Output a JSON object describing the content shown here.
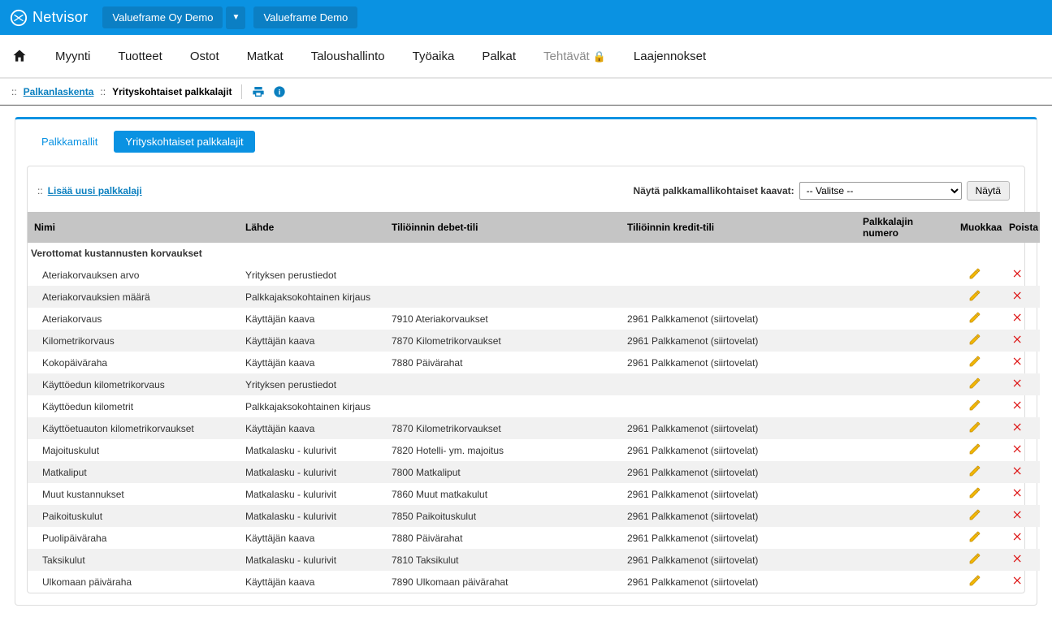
{
  "brand": "Netvisor",
  "company_selector": {
    "primary": "Valueframe Oy Demo",
    "secondary": "Valueframe Demo"
  },
  "mainnav": {
    "items": [
      {
        "label": "Myynti"
      },
      {
        "label": "Tuotteet"
      },
      {
        "label": "Ostot"
      },
      {
        "label": "Matkat"
      },
      {
        "label": "Taloushallinto"
      },
      {
        "label": "Työaika"
      },
      {
        "label": "Palkat"
      },
      {
        "label": "Tehtävät",
        "disabled": true
      },
      {
        "label": "Laajennokset"
      }
    ]
  },
  "breadcrumb": {
    "root": "Palkanlaskenta",
    "current": "Yrityskohtaiset palkkalajit"
  },
  "tabs": {
    "inactive": "Palkkamallit",
    "active": "Yrityskohtaiset palkkalajit"
  },
  "add_link": "Lisää uusi palkkalaji",
  "filter": {
    "label": "Näytä palkkamallikohtaiset kaavat:",
    "selected": "-- Valitse --",
    "button": "Näytä"
  },
  "table": {
    "headers": {
      "nimi": "Nimi",
      "lahde": "Lähde",
      "debet": "Tiliöinnin debet-tili",
      "kredit": "Tiliöinnin kredit-tili",
      "numero": "Palkkalajin numero",
      "muokkaa": "Muokkaa",
      "poista": "Poista"
    },
    "group_title": "Verottomat kustannusten korvaukset",
    "rows": [
      {
        "nimi": "Ateriakorvauksen arvo",
        "lahde": "Yrityksen perustiedot",
        "debet": "",
        "kredit": ""
      },
      {
        "nimi": "Ateriakorvauksien määrä",
        "lahde": "Palkkajaksokohtainen kirjaus",
        "debet": "",
        "kredit": ""
      },
      {
        "nimi": "Ateriakorvaus",
        "lahde": "Käyttäjän kaava",
        "debet": "7910 Ateriakorvaukset",
        "kredit": "2961 Palkkamenot (siirtovelat)"
      },
      {
        "nimi": "Kilometrikorvaus",
        "lahde": "Käyttäjän kaava",
        "debet": "7870 Kilometrikorvaukset",
        "kredit": "2961 Palkkamenot (siirtovelat)"
      },
      {
        "nimi": "Kokopäiväraha",
        "lahde": "Käyttäjän kaava",
        "debet": "7880 Päivärahat",
        "kredit": "2961 Palkkamenot (siirtovelat)"
      },
      {
        "nimi": "Käyttöedun kilometrikorvaus",
        "lahde": "Yrityksen perustiedot",
        "debet": "",
        "kredit": ""
      },
      {
        "nimi": "Käyttöedun kilometrit",
        "lahde": "Palkkajaksokohtainen kirjaus",
        "debet": "",
        "kredit": ""
      },
      {
        "nimi": "Käyttöetuauton kilometrikorvaukset",
        "lahde": "Käyttäjän kaava",
        "debet": "7870 Kilometrikorvaukset",
        "kredit": "2961 Palkkamenot (siirtovelat)"
      },
      {
        "nimi": "Majoituskulut",
        "lahde": "Matkalasku - kulurivit",
        "debet": "7820 Hotelli- ym. majoitus",
        "kredit": "2961 Palkkamenot (siirtovelat)"
      },
      {
        "nimi": "Matkaliput",
        "lahde": "Matkalasku - kulurivit",
        "debet": "7800 Matkaliput",
        "kredit": "2961 Palkkamenot (siirtovelat)"
      },
      {
        "nimi": "Muut kustannukset",
        "lahde": "Matkalasku - kulurivit",
        "debet": "7860 Muut matkakulut",
        "kredit": "2961 Palkkamenot (siirtovelat)"
      },
      {
        "nimi": "Paikoituskulut",
        "lahde": "Matkalasku - kulurivit",
        "debet": "7850 Paikoituskulut",
        "kredit": "2961 Palkkamenot (siirtovelat)"
      },
      {
        "nimi": "Puolipäiväraha",
        "lahde": "Käyttäjän kaava",
        "debet": "7880 Päivärahat",
        "kredit": "2961 Palkkamenot (siirtovelat)"
      },
      {
        "nimi": "Taksikulut",
        "lahde": "Matkalasku - kulurivit",
        "debet": "7810 Taksikulut",
        "kredit": "2961 Palkkamenot (siirtovelat)"
      },
      {
        "nimi": "Ulkomaan päiväraha",
        "lahde": "Käyttäjän kaava",
        "debet": "7890 Ulkomaan päivärahat",
        "kredit": "2961 Palkkamenot (siirtovelat)"
      }
    ]
  }
}
